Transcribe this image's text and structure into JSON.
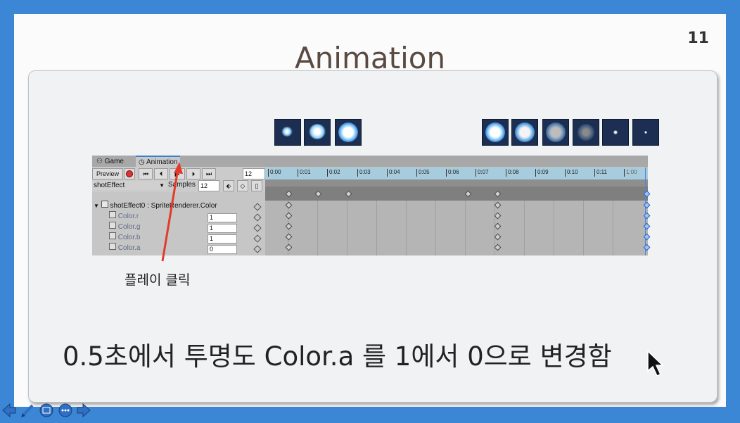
{
  "slide": {
    "title": "Animation",
    "page_number": "11",
    "annotation": "플레이 클릭",
    "main_text": "0.5초에서 투명도 Color.a 를 1에서 0으로 변경함"
  },
  "unity": {
    "tabs": [
      {
        "label": "Game"
      },
      {
        "label": "Animation"
      }
    ],
    "preview_label": "Preview",
    "frame_field": "12",
    "clip_name": "shotEffect",
    "samples_label": "Samples",
    "samples_value": "12",
    "timeline_ticks": [
      "0:00",
      "0:01",
      "0:02",
      "0:03",
      "0:04",
      "0:05",
      "0:06",
      "0:07",
      "0:08",
      "0:09",
      "0:10",
      "0:11",
      "1:00"
    ],
    "property_group": "shotEffect0 : SpriteRenderer.Color",
    "properties": [
      {
        "name": "Color.r",
        "value": "1"
      },
      {
        "name": "Color.g",
        "value": "1"
      },
      {
        "name": "Color.b",
        "value": "1"
      },
      {
        "name": "Color.a",
        "value": "0"
      }
    ]
  }
}
